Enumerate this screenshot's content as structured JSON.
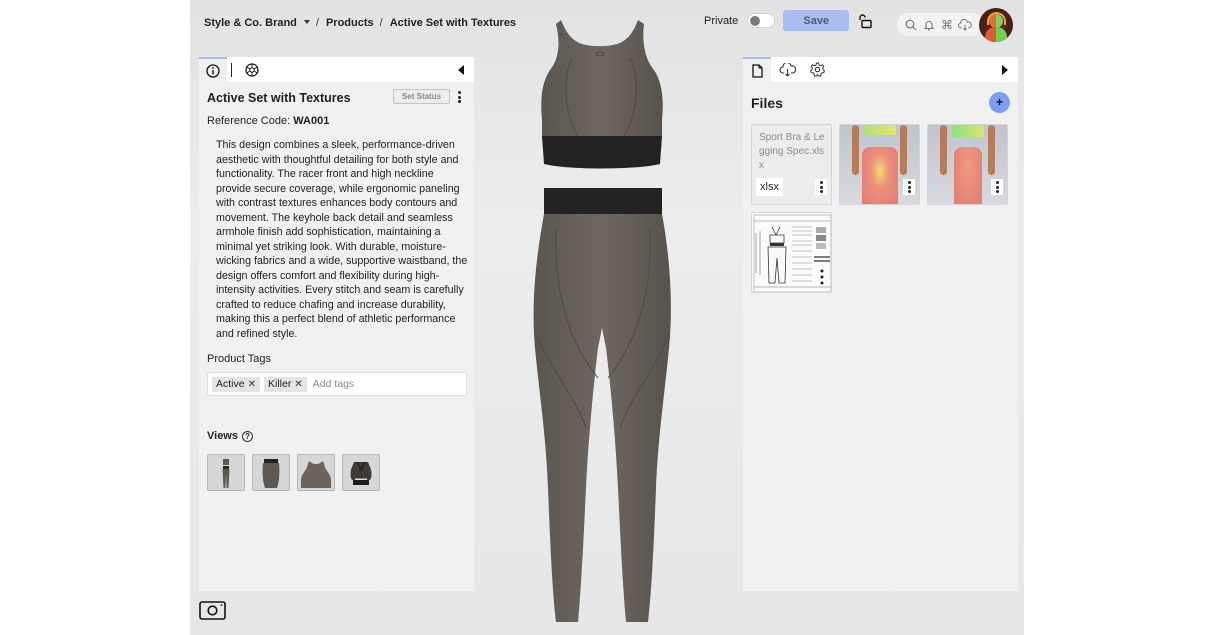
{
  "breadcrumb": {
    "brand": "Style & Co. Brand",
    "section": "Products",
    "current": "Active Set with Textures",
    "separator": "/"
  },
  "header": {
    "private_label": "Private",
    "private_enabled": false,
    "save_label": "Save",
    "icons": [
      "lock-open-icon",
      "search-icon",
      "bell-icon",
      "command-icon",
      "cloud-download-icon"
    ],
    "avatar": "user-avatar"
  },
  "left_panel": {
    "tabs": [
      {
        "name": "info-icon",
        "active": true
      },
      {
        "name": "palette-icon",
        "active": false
      }
    ],
    "title": "Active Set with Textures",
    "set_status_label": "Set Status",
    "reference_label": "Reference Code:",
    "reference_code": "WA001",
    "description": "This design combines a sleek, performance-driven aesthetic with thoughtful detailing for both style and functionality. The racer front and high neckline provide secure coverage, while ergonomic paneling with contrast textures enhances body contours and movement. The keyhole back detail and seamless armhole finish add sophistication, maintaining a minimal yet striking look. With durable, moisture-wicking fabrics and a wide, supportive waistband, the design offers comfort and flexibility during high-intensity activities. Every stitch and seam is carefully crafted to reduce chafing and increase durability, making this a perfect blend of athletic performance and refined style.",
    "tags_label": "Product Tags",
    "tags": [
      "Active",
      "Killer"
    ],
    "tags_placeholder": "Add tags",
    "views_label": "Views",
    "views": [
      {
        "name": "full-outfit-view"
      },
      {
        "name": "leggings-view"
      },
      {
        "name": "bra-front-view"
      },
      {
        "name": "bra-back-view"
      }
    ]
  },
  "right_panel": {
    "tabs": [
      {
        "name": "file-icon",
        "active": true
      },
      {
        "name": "cloud-download-icon",
        "active": false
      },
      {
        "name": "settings-icon",
        "active": false
      }
    ],
    "title": "Files",
    "add_label": "+",
    "files": [
      {
        "name": "Sport Bra & Legging Spec.xlsx",
        "ext": "xlsx",
        "type": "document"
      },
      {
        "name": "fit-heatmap-back",
        "type": "heatmap-image"
      },
      {
        "name": "fit-heatmap-front",
        "type": "heatmap-image"
      },
      {
        "name": "tech-pack-sheet",
        "type": "tech-sheet-image"
      }
    ]
  },
  "viewport": {
    "garment": "sports bra and leggings 3D model",
    "colors": {
      "fabric": "#6b645e",
      "band": "#242322"
    }
  },
  "colors": {
    "accent": "#a9bdf0",
    "add_button": "#7c9ef0",
    "panel_bg": "#f0f0f0"
  }
}
